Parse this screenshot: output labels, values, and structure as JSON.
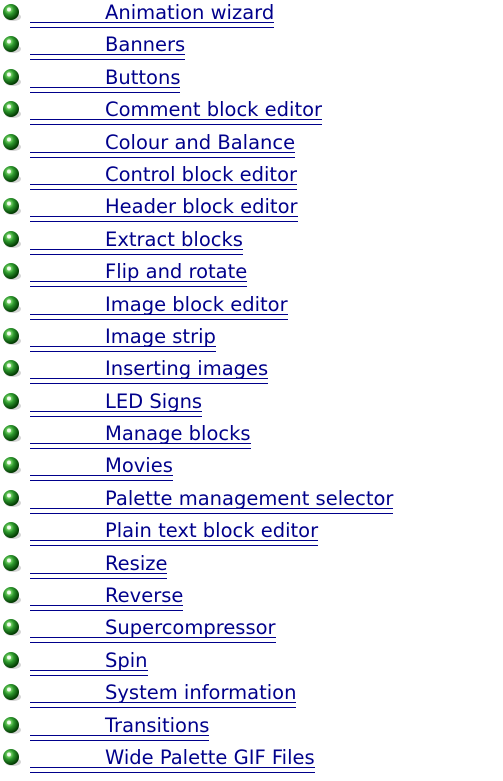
{
  "icon": "green-ball-bullet-icon",
  "colors": {
    "link": "#00008b",
    "bullet_highlight": "#b8ff9a",
    "bullet_mid": "#2e9a2e",
    "bullet_dark": "#003800"
  },
  "topics": [
    {
      "label": "Animation wizard"
    },
    {
      "label": "Banners"
    },
    {
      "label": "Buttons"
    },
    {
      "label": "Comment block editor"
    },
    {
      "label": "Colour and Balance"
    },
    {
      "label": "Control block editor"
    },
    {
      "label": "Header block editor"
    },
    {
      "label": "Extract blocks"
    },
    {
      "label": "Flip and rotate"
    },
    {
      "label": "Image block editor"
    },
    {
      "label": "Image strip"
    },
    {
      "label": "Inserting images"
    },
    {
      "label": "LED Signs"
    },
    {
      "label": "Manage blocks"
    },
    {
      "label": "Movies"
    },
    {
      "label": "Palette management selector"
    },
    {
      "label": "Plain text block editor"
    },
    {
      "label": "Resize"
    },
    {
      "label": "Reverse"
    },
    {
      "label": "Supercompressor"
    },
    {
      "label": "Spin"
    },
    {
      "label": "System information"
    },
    {
      "label": "Transitions"
    },
    {
      "label": "Wide Palette GIF Files"
    }
  ]
}
